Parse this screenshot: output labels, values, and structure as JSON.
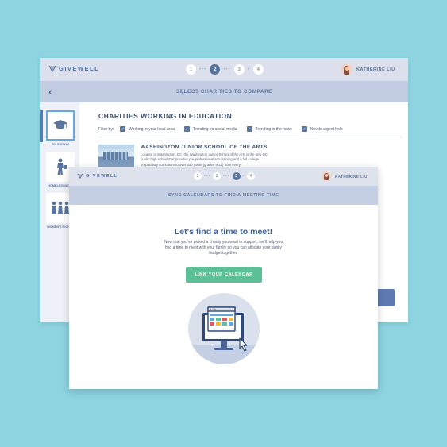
{
  "back_window": {
    "brand": "GIVEWELL",
    "steps": [
      "1",
      "2",
      "3",
      "4"
    ],
    "active_step": "2",
    "user_name": "KATHERINE LIU",
    "subheader": "SELECT CHARITIES TO COMPARE",
    "categories": [
      {
        "label": "EDUCATION",
        "icon": "graduation-cap-icon",
        "selected": true
      },
      {
        "label": "HOMELESSNESS",
        "icon": "homeless-person-icon",
        "selected": false
      },
      {
        "label": "WOMEN'S RIGHTS",
        "icon": "women-group-icon",
        "selected": false
      }
    ],
    "section_title": "CHARITIES WORKING IN EDUCATION",
    "filter_label": "Filter by:",
    "filters": [
      "Working in your local area",
      "Trending on social media",
      "Trending in the news",
      "Needs urgent help"
    ],
    "charity": {
      "name": "WASHINGTON JUNIOR SCHOOL OF THE ARTS",
      "description": "Located in Washington, DC, the Washington Junior School of the Arts is the only DC public high school that provides pre-professional arts training and a full college preparatory curriculum to over 530 youth (grades 9-12) from every"
    }
  },
  "front_window": {
    "brand": "GIVEWELL",
    "steps": [
      "1",
      "2",
      "3",
      "4"
    ],
    "active_step": "3",
    "user_name": "KATHERINE LIU",
    "subheader": "SYNC CALENDARS TO FIND A MEETING TIME",
    "headline": "Let's find a time to meet!",
    "body": "Now that you've picked a charity you want to support, we'll help you find a time to meet with your family so you can allocate your family budget together.",
    "button_label": "LINK YOUR CALENDAR",
    "illustration_icon": "calendar-monitor-icon"
  },
  "colors": {
    "background": "#8dd3e0",
    "brand_blue": "#59749e",
    "button_green": "#5dbf95"
  }
}
